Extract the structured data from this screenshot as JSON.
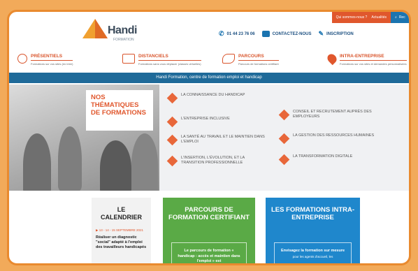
{
  "topbar": {
    "who_label": "Qui sommes-nous ?",
    "news_label": "Actualités",
    "search_label": "Rec"
  },
  "header": {
    "logo_text": "Handi",
    "logo_sub": "FORMATION",
    "phone": "01 44 23 76 06",
    "contact_label": "CONTACTEZ-NOUS",
    "inscription_label": "INSCRIPTION"
  },
  "nav": {
    "items": [
      {
        "title": "PRÉSENTIELS",
        "sub": "Formations sur vos sites (en inter)"
      },
      {
        "title": "DISTANCIELS",
        "sub": "Formations sans vous déplacer (classes virtuelles)"
      },
      {
        "title": "PARCOURS",
        "sub": "Parcours de formations certifiant"
      },
      {
        "title": "INTRA-ENTREPRISE",
        "sub": "Formations sur vos sites et demandes personnalisées"
      }
    ]
  },
  "banner": "Handi Formation, centre de formation emploi et handicap",
  "hero": {
    "title_lines": [
      "NOS",
      "THÉMATIQUES",
      "DE FORMATIONS"
    ],
    "themes": [
      "LA CONNAISSANCE DU HANDICAP",
      "L'ENTREPRISE INCLUSIVE",
      "LA SANTÉ AU TRAVAIL ET LE MAINTIEN DANS L'EMPLOI",
      "L'INSERTION, L'ÉVOLUTION, ET LA TRANSITION PROFESSIONNELLE",
      "CONSEIL ET RECRUTEMENT AUPRÈS DES EMPLOYEURS",
      "LA GESTION DES RESSOURCES HUMAINES",
      "LA TRANSFORMATION DIGITALE"
    ]
  },
  "cards": {
    "calendar": {
      "title_line1": "LE",
      "title_line2": "CALENDRIER",
      "date": "▶ 13 - 14 - 15 SEPTEMBRE 2021",
      "text": "Réaliser un diagnostic \"social\" adapté à l'emploi des travailleurs handicapés"
    },
    "green": {
      "title": "PARCOURS DE FORMATION CERTIFIANT",
      "box_text": "Le parcours de formation « handicap : accès et maintien dans l'emploi » est"
    },
    "blue": {
      "title": "LES FORMATIONS INTRA-ENTREPRISE",
      "box_text": "Envisagez la formation sur mesure",
      "box_sub": "pour les agents d'accueil, les"
    }
  }
}
